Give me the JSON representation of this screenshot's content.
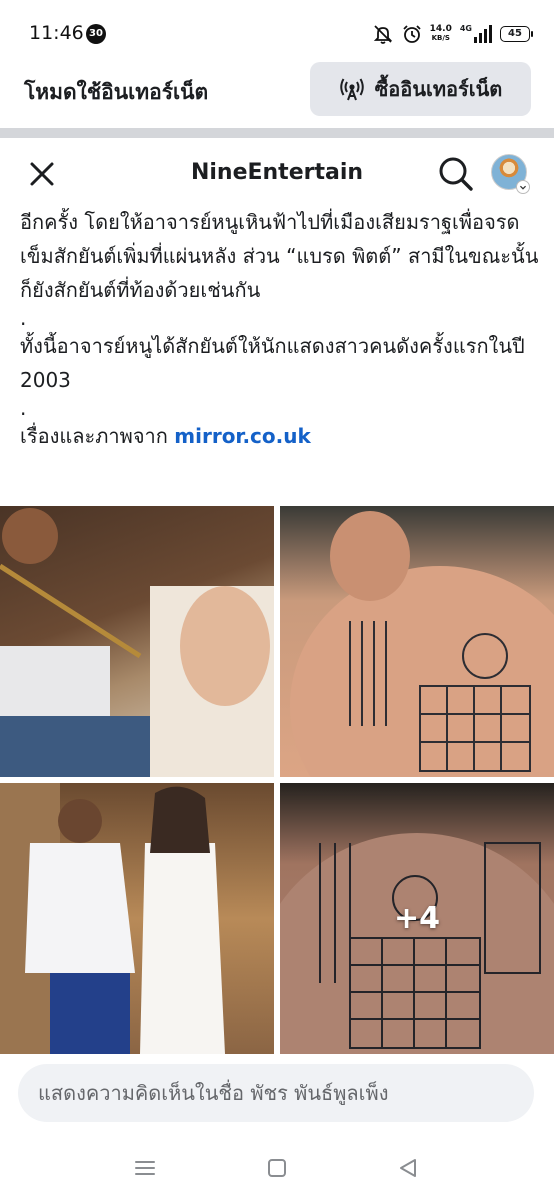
{
  "status": {
    "time": "11:46",
    "notif_count": "30",
    "net_speed_value": "14.0",
    "net_speed_unit": "KB/S",
    "network": "4G",
    "battery": "45"
  },
  "mode_bar": {
    "label": "โหมดใช้อินเทอร์เน็ต",
    "buy_button": "ซื้ออินเทอร์เน็ต"
  },
  "header": {
    "page_name": "NineEntertain"
  },
  "post": {
    "paragraph1": "อีกครั้ง โดยให้อาจารย์หนูเหินฟ้าไปที่เมืองเสียมราฐเพื่อจรดเข็มสักยันต์เพิ่มที่แผ่นหลัง ส่วน “แบรด พิตต์” สามีในขณะนั้นก็ยังสักยันต์ที่ท้องด้วยเช่นกัน",
    "dot1": ".",
    "paragraph2": "ทั้งนี้อาจารย์หนูได้สักยันต์ให้นักแสดงสาวคนดังครั้งแรกในปี 2003",
    "dot2": ".",
    "source_prefix": "เรื่องและภาพจาก ",
    "source_link": "mirror.co.uk"
  },
  "photos": {
    "more_count": "+4"
  },
  "comment": {
    "placeholder": "แสดงความคิดเห็นในชื่อ พัชร พันธ์พูลเพ็ง"
  }
}
